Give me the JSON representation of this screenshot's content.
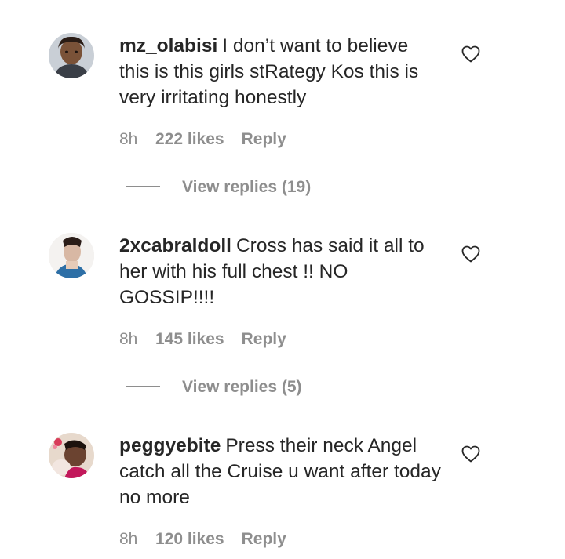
{
  "comments": [
    {
      "username": "mz_olabisi",
      "text": "I don’t want to believe this is this girls stRategy Kos this is very irritating honestly",
      "time": "8h",
      "likes": "222 likes",
      "reply": "Reply",
      "view_replies": "View replies (19)",
      "avatar_icon": "profile-photo-icon"
    },
    {
      "username": "2xcabraldoll",
      "text": "Cross has said it all to her with his full chest !! NO GOSSIP!!!!",
      "time": "8h",
      "likes": "145 likes",
      "reply": "Reply",
      "view_replies": "View replies (5)",
      "avatar_icon": "profile-photo-icon"
    },
    {
      "username": "peggyebite",
      "text": "Press their neck Angel catch all the Cruise u want after today no more",
      "time": "8h",
      "likes": "120 likes",
      "reply": "Reply",
      "avatar_icon": "profile-photo-icon"
    }
  ],
  "icons": {
    "like": "heart-outline-icon"
  },
  "colors": {
    "text": "#262626",
    "secondary": "#8e8e8e",
    "background": "#ffffff"
  }
}
